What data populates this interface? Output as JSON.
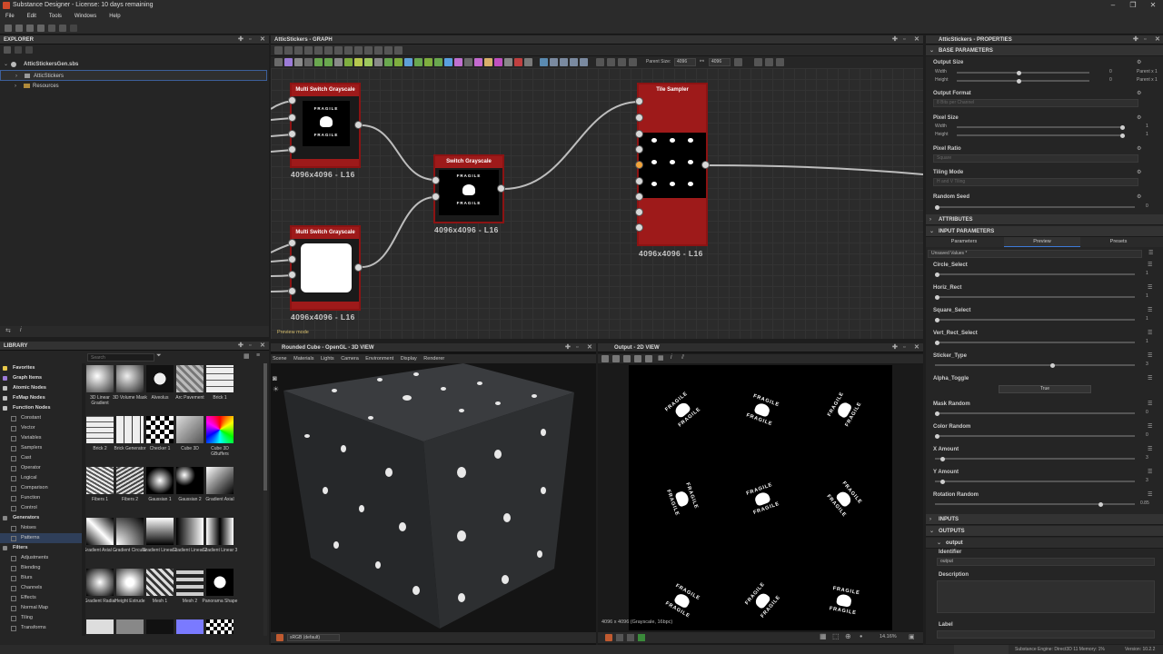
{
  "window": {
    "title": "Substance Designer - License: 10 days remaining"
  },
  "menu": [
    "File",
    "Edit",
    "Tools",
    "Windows",
    "Help"
  ],
  "explorer": {
    "title": "EXPLORER",
    "items": [
      {
        "label": "AtticStickersGen.sbs"
      },
      {
        "label": "AtticStickers"
      },
      {
        "label": "Resources"
      }
    ]
  },
  "graph": {
    "title": "AtticStickers - GRAPH",
    "parent_size_label": "Parent Size:",
    "parent_size_w": "4096",
    "parent_size_h": "4096",
    "preview_mode": "Preview mode",
    "nodes": [
      {
        "title": "Multi Switch Grayscale",
        "res": "4096x4096 - L16"
      },
      {
        "title": "Switch Grayscale",
        "res": "4096x4096 - L16"
      },
      {
        "title": "Multi Switch Grayscale",
        "res": "4096x4096 - L16"
      },
      {
        "title": "Tile Sampler",
        "res": "4096x4096 - L16"
      }
    ],
    "fragile": "FRAGILE"
  },
  "properties": {
    "title": "AtticStickers - PROPERTIES",
    "base_parameters": "BASE PARAMETERS",
    "output_size": "Output Size",
    "width": "Width",
    "height": "Height",
    "zero": "0",
    "parent_x1": "Parent x 1",
    "output_format": "Output Format",
    "output_format_value": "8 Bits per Channel",
    "pixel_size": "Pixel Size",
    "one": "1",
    "pixel_ratio": "Pixel Ratio",
    "pixel_ratio_value": "Square",
    "tiling_mode": "Tiling Mode",
    "tiling_mode_value": "H and V Tiling",
    "random_seed": "Random Seed",
    "attributes": "ATTRIBUTES",
    "input_parameters": "INPUT PARAMETERS",
    "tabs": [
      "Parameters",
      "Preview",
      "Presets"
    ],
    "unsaved": "Unsaved Values *",
    "params": [
      {
        "name": "Circle_Select",
        "value": "1",
        "level": 0.0
      },
      {
        "name": "Horiz_Rect",
        "value": "1",
        "level": 0.0
      },
      {
        "name": "Square_Select",
        "value": "1",
        "level": 0.0
      },
      {
        "name": "Vert_Rect_Select",
        "value": "1",
        "level": 0.0
      },
      {
        "name": "Sticker_Type",
        "value": "3",
        "level": 0.6
      },
      {
        "name": "Alpha_Toggle",
        "value": "True"
      },
      {
        "name": "Mask Random",
        "value": "0",
        "level": 0.0
      },
      {
        "name": "Color Random",
        "value": "0",
        "level": 0.0
      },
      {
        "name": "X Amount",
        "value": "3",
        "level": 0.03
      },
      {
        "name": "Y Amount",
        "value": "3",
        "level": 0.03
      },
      {
        "name": "Rotation Random",
        "value": "0.85",
        "level": 0.85
      }
    ],
    "inputs": "INPUTS",
    "outputs": "OUTPUTS",
    "output_name": "output",
    "identifier": "Identifier",
    "identifier_value": "output",
    "description": "Description",
    "label": "Label"
  },
  "library": {
    "title": "LIBRARY",
    "search_placeholder": "Search",
    "categories": [
      {
        "label": "Favorites",
        "hdr": true
      },
      {
        "label": "Graph Items",
        "hdr": true
      },
      {
        "label": "Atomic Nodes",
        "hdr": true
      },
      {
        "label": "FxMap Nodes",
        "hdr": true
      },
      {
        "label": "Function Nodes",
        "hdr": true
      },
      {
        "label": "Constant"
      },
      {
        "label": "Vector"
      },
      {
        "label": "Variables"
      },
      {
        "label": "Samplers"
      },
      {
        "label": "Cast"
      },
      {
        "label": "Operator"
      },
      {
        "label": "Logical"
      },
      {
        "label": "Comparison"
      },
      {
        "label": "Function"
      },
      {
        "label": "Control"
      },
      {
        "label": "Generators",
        "hdr": true
      },
      {
        "label": "Noises"
      },
      {
        "label": "Patterns"
      },
      {
        "label": "Filters",
        "hdr": true
      },
      {
        "label": "Adjustments"
      },
      {
        "label": "Blending"
      },
      {
        "label": "Blurs"
      },
      {
        "label": "Channels"
      },
      {
        "label": "Effects"
      },
      {
        "label": "Normal Map"
      },
      {
        "label": "Tiling"
      },
      {
        "label": "Transforms"
      }
    ],
    "thumbs": [
      "3D Linear Gradient",
      "3D Volume Mask",
      "Alveolus",
      "Arc Pavement",
      "Brick 1",
      "Brick 2",
      "Brick Generator",
      "Checker 1",
      "Cube 3D",
      "Cube 3D GBuffers",
      "Fibers 1",
      "Fibers 2",
      "Gaussian 1",
      "Gaussian 2",
      "Gradient Axial",
      "Gradient Axial ...",
      "Gradient Circular",
      "Gradient Linear 1",
      "Gradient Linear 2",
      "Gradient Linear 3",
      "Gradient Radial",
      "Height Extrude",
      "Mesh 1",
      "Mesh 2",
      "Panorama Shape"
    ]
  },
  "view3d": {
    "title": "Rounded Cube - OpenGL - 3D VIEW",
    "menu": [
      "Scene",
      "Materials",
      "Lights",
      "Camera",
      "Environment",
      "Display",
      "Renderer"
    ],
    "colorspace": "sRGB (default)"
  },
  "view2d": {
    "title": "Output - 2D VIEW",
    "info": "4096 x 4096 (Grayscale, 16bpc)",
    "zoom": "14.16%"
  },
  "status": {
    "engine": "Substance Engine: Direct3D 11  Memory: 1%",
    "version": "Version: 10.2.2"
  }
}
